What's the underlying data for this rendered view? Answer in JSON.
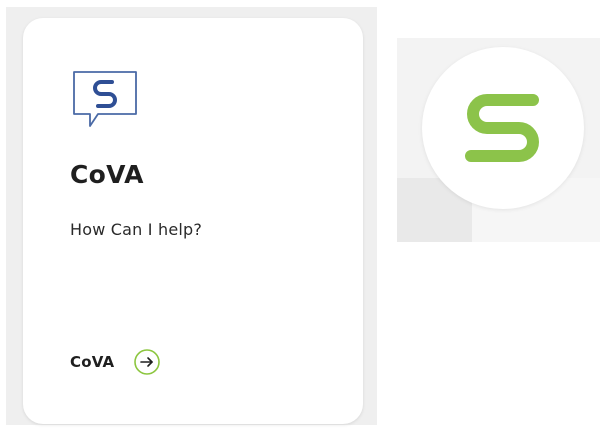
{
  "card": {
    "title": "CoVA",
    "subtitle": "How Can I help?",
    "link_label": "CoVA"
  },
  "icons": {
    "chat": "chat-bubble-s-icon",
    "arrow": "arrow-right-circle-icon",
    "logo": "s-logo-icon"
  },
  "colors": {
    "chat_outline": "#4a6aa6",
    "chat_letter": "#2f4f95",
    "arrow_ring": "#8cc63f",
    "logo_green": "#8cc34a"
  }
}
